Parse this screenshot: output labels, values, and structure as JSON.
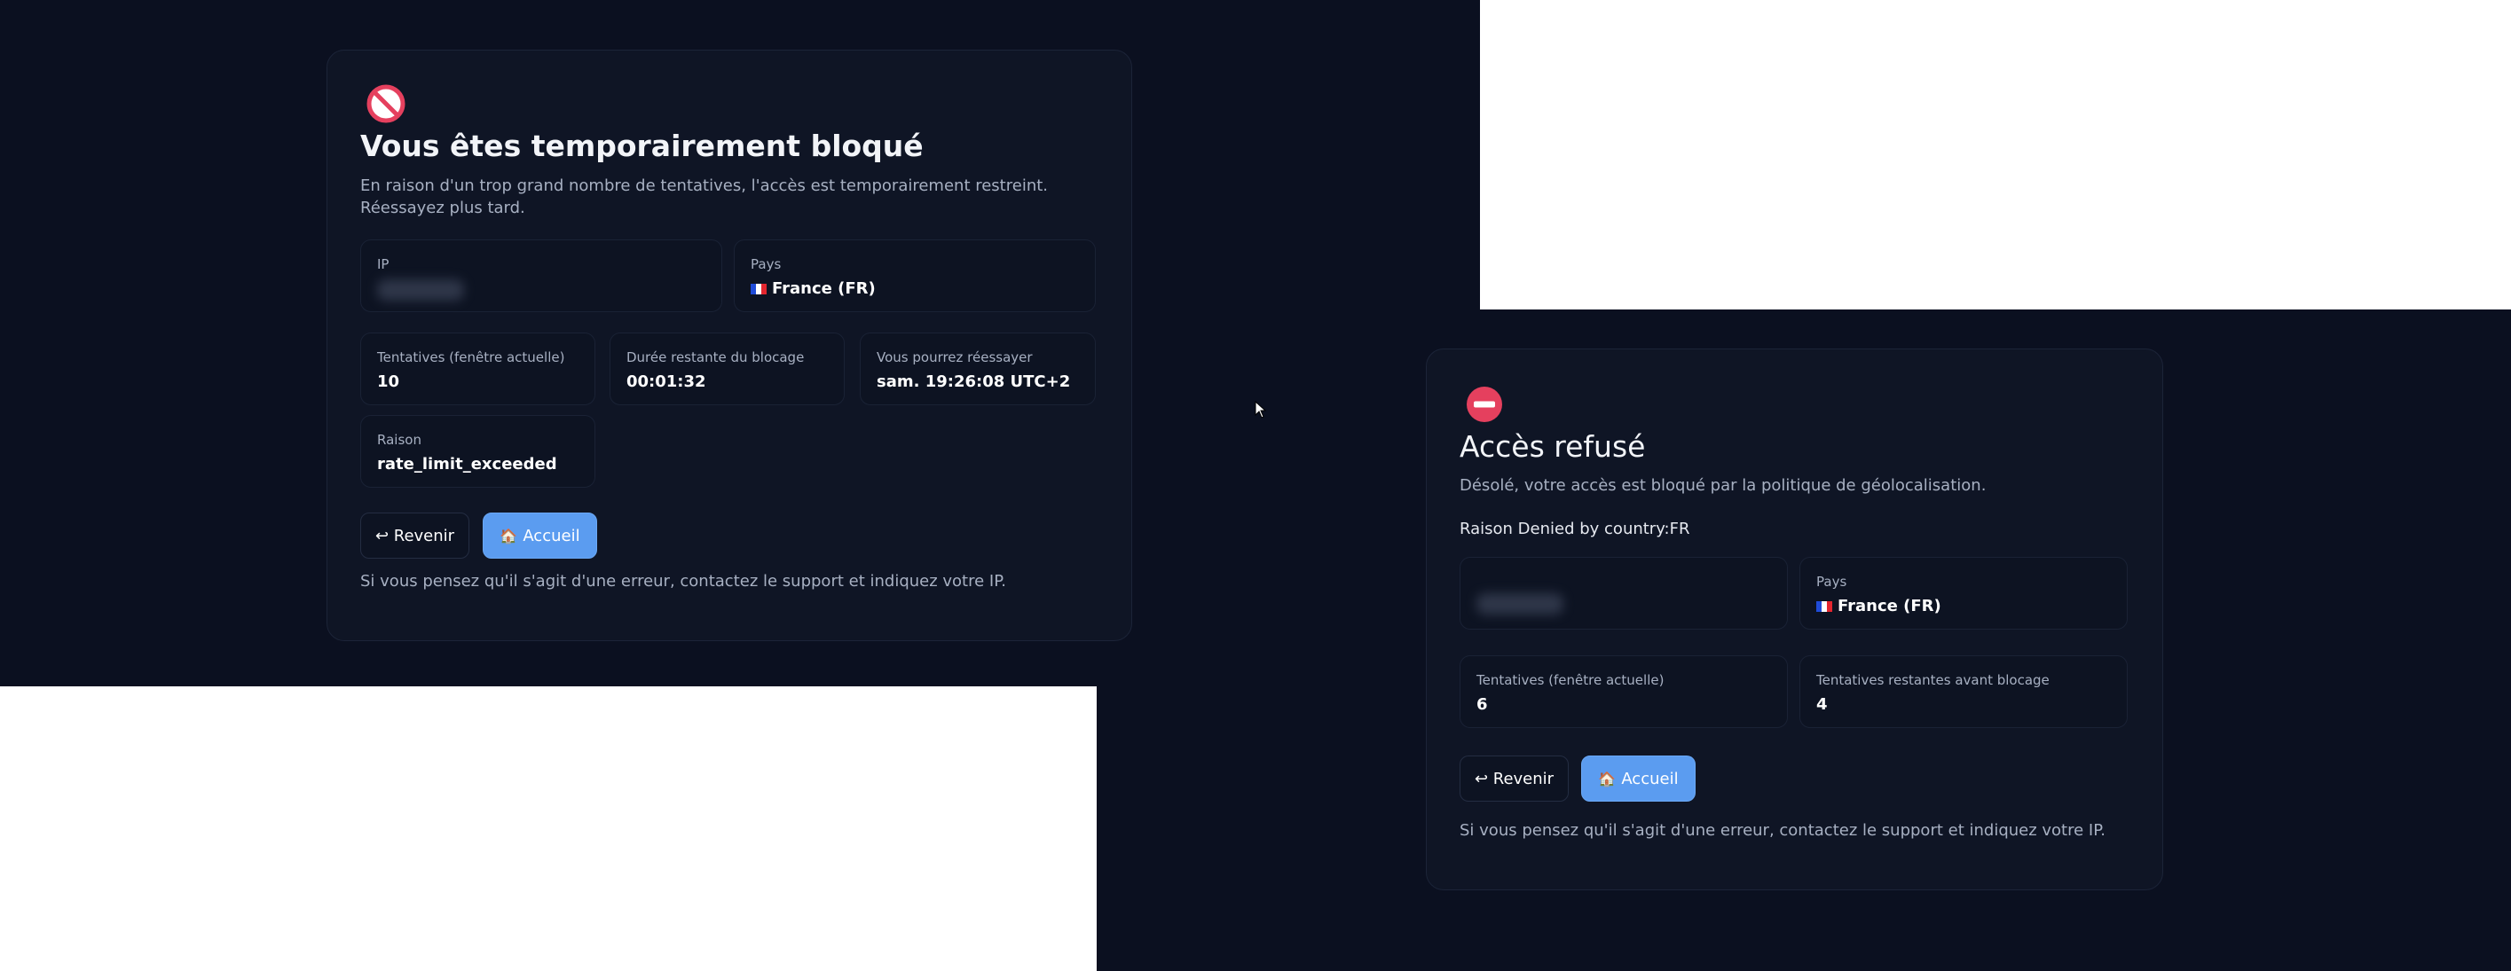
{
  "theme": {
    "background": "#0b1020",
    "card": "#0f1525",
    "accent": "#5b9cf0",
    "danger": "#e5405e"
  },
  "blocked_card": {
    "icon": "no-entry-sign-icon",
    "title": "Vous êtes temporairement bloqué",
    "description": "En raison d'un trop grand nombre de tentatives, l'accès est temporairement restreint. Réessayez plus tard.",
    "ip": {
      "label": "IP"
    },
    "country": {
      "label": "Pays",
      "value": "France (FR)"
    },
    "attempts": {
      "label": "Tentatives (fenêtre actuelle)",
      "value": "10"
    },
    "remaining": {
      "label": "Durée restante du blocage",
      "value": "00:01:32"
    },
    "retry": {
      "label": "Vous pourrez réessayer",
      "value": "sam. 19:26:08 UTC+2"
    },
    "reason": {
      "label": "Raison",
      "value": "rate_limit_exceeded"
    },
    "back_button": "↩ Revenir",
    "home_button": "Accueil",
    "footnote": "Si vous pensez qu'il s'agit d'une erreur, contactez le support et indiquez votre IP."
  },
  "denied_card": {
    "icon": "minus-circle-icon",
    "title": "Accès refusé",
    "description": "Désolé, votre accès est bloqué par la politique de géolocalisation.",
    "reason_line": "Raison Denied by country:FR",
    "country": {
      "label": "Pays",
      "value": "France (FR)"
    },
    "attempts": {
      "label": "Tentatives (fenêtre actuelle)",
      "value": "6"
    },
    "attempts_left": {
      "label": "Tentatives restantes avant blocage",
      "value": "4"
    },
    "back_button": "↩ Revenir",
    "home_button": "Accueil",
    "footnote": "Si vous pensez qu'il s'agit d'une erreur, contactez le support et indiquez votre IP."
  }
}
